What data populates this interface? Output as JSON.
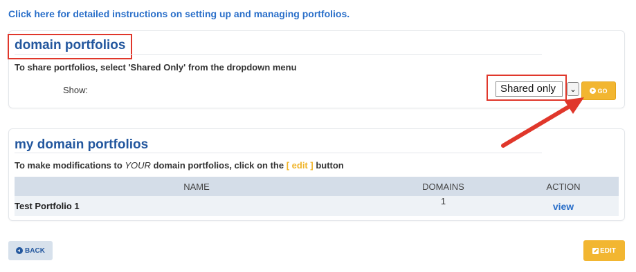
{
  "instructions_link": "Click here for detailed instructions on setting up and managing portfolios.",
  "panel_domain": {
    "title": "domain portfolios",
    "hint": "To share portfolios, select 'Shared Only' from the dropdown menu",
    "show_label": "Show:",
    "select_value": "Shared only",
    "select_arrow": "⌄",
    "go_label": "GO"
  },
  "panel_my": {
    "title": "my domain portfolios",
    "hint_prefix": "To make modifications to ",
    "hint_emph": "YOUR",
    "hint_mid": " domain portfolios, click on the ",
    "hint_edit": "[ edit ]",
    "hint_suffix": " button",
    "table": {
      "headers": [
        "NAME",
        "DOMAINS",
        "ACTION"
      ],
      "rows": [
        {
          "name": "Test Portfolio 1",
          "domains": "1",
          "action": "view"
        }
      ]
    }
  },
  "footer": {
    "back_label": "BACK",
    "edit_label": "EDIT"
  },
  "colors": {
    "link_blue": "#2a6fc9",
    "title_blue": "#23579e",
    "accent_yellow": "#f2b631",
    "annotation_red": "#e0372b"
  },
  "icons": {
    "go": "play-circle-icon",
    "back": "back-circle-icon",
    "edit": "edit-square-icon"
  }
}
